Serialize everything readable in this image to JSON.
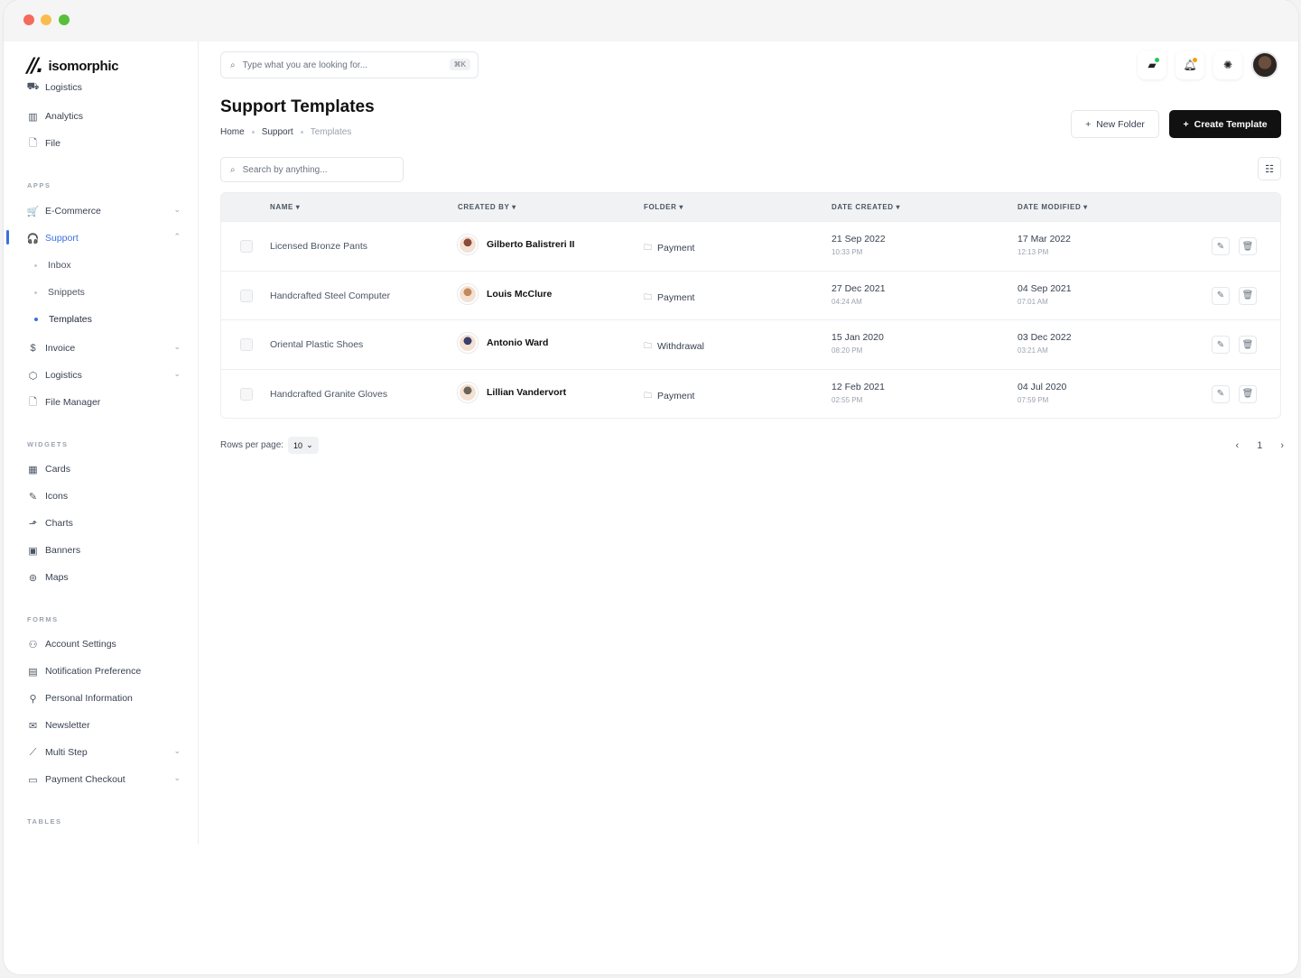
{
  "app": {
    "brand": "isomorphic"
  },
  "sidebar": {
    "top_items": [
      {
        "label": "Logistics",
        "icon": "truck-icon"
      },
      {
        "label": "Analytics",
        "icon": "bar-chart-icon"
      },
      {
        "label": "File",
        "icon": "file-icon"
      }
    ],
    "sections": {
      "apps": "APPS",
      "widgets": "WIDGETS",
      "forms": "FORMS",
      "tables": "TABLES"
    },
    "apps": [
      {
        "label": "E-Commerce",
        "icon": "cart-icon"
      },
      {
        "label": "Support",
        "icon": "headset-icon"
      },
      {
        "label": "Invoice",
        "icon": "dollar-icon"
      },
      {
        "label": "Logistics",
        "icon": "package-icon"
      },
      {
        "label": "File Manager",
        "icon": "file-manager-icon"
      }
    ],
    "support_sub": [
      "Inbox",
      "Snippets",
      "Templates"
    ],
    "widgets": [
      {
        "label": "Cards",
        "icon": "cards-icon"
      },
      {
        "label": "Icons",
        "icon": "feather-icon"
      },
      {
        "label": "Charts",
        "icon": "chart-icon"
      },
      {
        "label": "Banners",
        "icon": "banner-icon"
      },
      {
        "label": "Maps",
        "icon": "map-pin-icon"
      }
    ],
    "forms": [
      {
        "label": "Account Settings",
        "icon": "user-settings-icon"
      },
      {
        "label": "Notification Preference",
        "icon": "notification-icon"
      },
      {
        "label": "Personal Information",
        "icon": "user-icon"
      },
      {
        "label": "Newsletter",
        "icon": "mail-icon"
      },
      {
        "label": "Multi Step",
        "icon": "steps-icon"
      },
      {
        "label": "Payment Checkout",
        "icon": "credit-card-icon"
      }
    ]
  },
  "header": {
    "search_placeholder": "Type what you are looking for...",
    "search_shortcut": "⌘K"
  },
  "page": {
    "title": "Support Templates",
    "breadcrumb": [
      "Home",
      "Support",
      "Templates"
    ],
    "new_folder_label": "New Folder",
    "create_template_label": "Create Template",
    "table_search_placeholder": "Search by anything..."
  },
  "table": {
    "columns": [
      "NAME",
      "CREATED BY",
      "FOLDER",
      "DATE CREATED",
      "DATE MODIFIED"
    ],
    "rows": [
      {
        "name": "Licensed Bronze Pants",
        "created_by": "Gilberto Balistreri II",
        "folder": "Payment",
        "date_created": "21 Sep 2022",
        "time_created": "10:33 PM",
        "date_modified": "17 Mar 2022",
        "time_modified": "12:13 PM",
        "avatar_color": "#8a4b3a"
      },
      {
        "name": "Handcrafted Steel Computer",
        "created_by": "Louis McClure",
        "folder": "Payment",
        "date_created": "27 Dec 2021",
        "time_created": "04:24 AM",
        "date_modified": "04 Sep 2021",
        "time_modified": "07:01 AM",
        "avatar_color": "#c48a5a"
      },
      {
        "name": "Oriental Plastic Shoes",
        "created_by": "Antonio Ward",
        "folder": "Withdrawal",
        "date_created": "15 Jan 2020",
        "time_created": "08:20 PM",
        "date_modified": "03 Dec 2022",
        "time_modified": "03:21 AM",
        "avatar_color": "#3b3f6b"
      },
      {
        "name": "Handcrafted Granite Gloves",
        "created_by": "Lillian Vandervort",
        "folder": "Payment",
        "date_created": "12 Feb 2021",
        "time_created": "02:55 PM",
        "date_modified": "04 Jul 2020",
        "time_modified": "07:59 PM",
        "avatar_color": "#6b6458"
      }
    ]
  },
  "footer": {
    "rows_per_page_label": "Rows per page:",
    "rows_per_page_value": "10",
    "current_page": "1"
  },
  "colors": {
    "accent": "#3b6fe0",
    "primary_button": "#111111"
  }
}
